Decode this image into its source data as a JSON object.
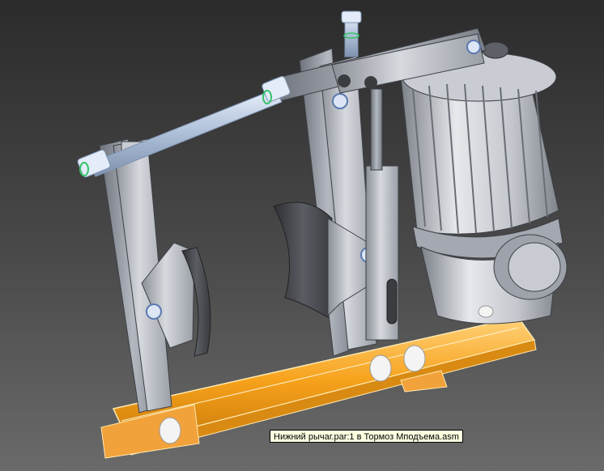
{
  "viewport": {
    "background_top": "#2b2b2b",
    "background_bottom": "#6a6a6a",
    "model": "drum-brake-assembly",
    "highlight_color": "#f7a21c",
    "selection_color": "#ffffff",
    "part_color": "#b8bcc4"
  },
  "tooltip": {
    "text": "Нижний рычаг.par:1 в Тормоз Мподъема.asm"
  }
}
